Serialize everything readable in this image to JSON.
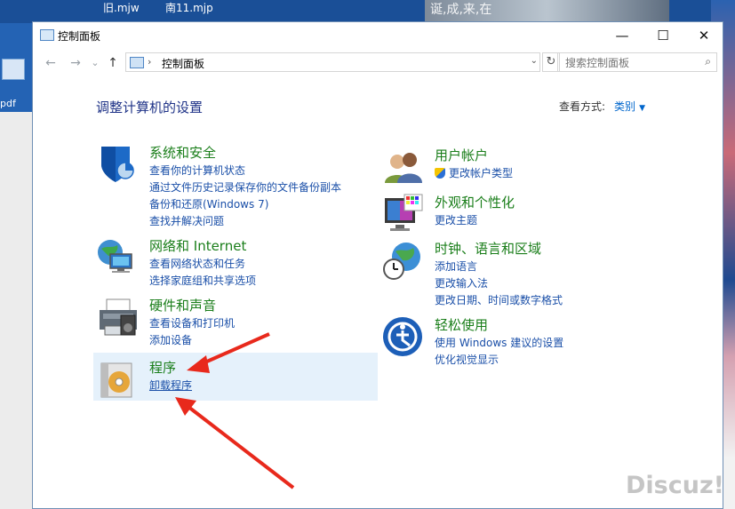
{
  "desktop": {
    "files": [
      "旧.mjw",
      "南11.mjp"
    ],
    "left_text": "pdf",
    "photo_text": "诞,成,来,在"
  },
  "window": {
    "title": "控制面板",
    "controls": {
      "minimize": "—",
      "maximize": "☐",
      "close": "✕"
    }
  },
  "address": {
    "back": "←",
    "forward": "→",
    "history": "⌄",
    "up": "↑",
    "separator": "›",
    "crumb": "控制面板",
    "dropdown": "⌄",
    "refresh": "↻",
    "search_placeholder": "搜索控制面板",
    "search_icon": "⌕"
  },
  "page": {
    "heading": "调整计算机的设置",
    "view_by_label": "查看方式:",
    "view_by_value": "类别"
  },
  "categories_left": [
    {
      "title": "系统和安全",
      "icon": "shield-icon",
      "links": [
        "查看你的计算机状态",
        "通过文件历史记录保存你的文件备份副本",
        "备份和还原(Windows 7)",
        "查找并解决问题"
      ]
    },
    {
      "title": "网络和 Internet",
      "icon": "network-globe-icon",
      "links": [
        "查看网络状态和任务",
        "选择家庭组和共享选项"
      ]
    },
    {
      "title": "硬件和声音",
      "icon": "printer-icon",
      "links": [
        "查看设备和打印机",
        "添加设备"
      ]
    },
    {
      "title": "程序",
      "icon": "programs-disc-icon",
      "links": [
        "卸载程序"
      ]
    }
  ],
  "categories_right": [
    {
      "title": "用户帐户",
      "icon": "users-icon",
      "links": [
        "更改帐户类型"
      ]
    },
    {
      "title": "外观和个性化",
      "icon": "appearance-monitor-icon",
      "links": [
        "更改主题"
      ]
    },
    {
      "title": "时钟、语言和区域",
      "icon": "clock-globe-icon",
      "links": [
        "添加语言",
        "更改输入法",
        "更改日期、时间或数字格式"
      ]
    },
    {
      "title": "轻松使用",
      "icon": "ease-of-access-icon",
      "links": [
        "使用 Windows 建议的设置",
        "优化视觉显示"
      ]
    }
  ],
  "colors": {
    "category_title": "#1a7e1a",
    "link": "#1a4fa8",
    "heading": "#1e3287",
    "highlight": "#e5f1fb",
    "annotation_arrow": "#e8291c"
  },
  "watermark": "Discuz!"
}
